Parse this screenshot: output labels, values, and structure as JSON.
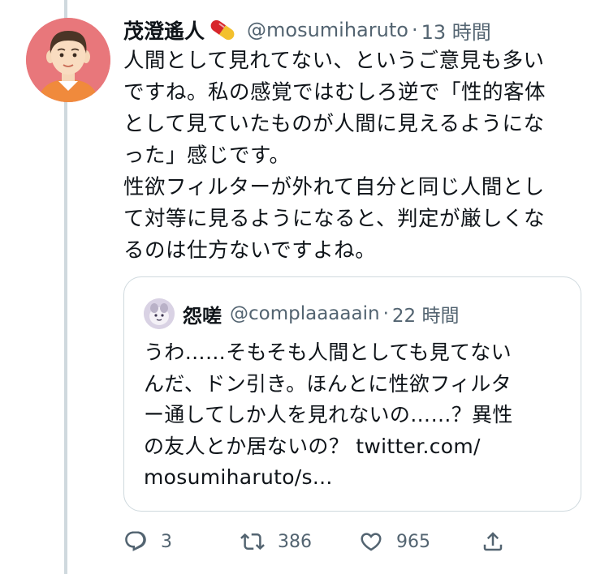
{
  "tweet": {
    "display_name": "茂澄遙人",
    "name_emoji": "pill-icon",
    "handle": "@mosumiharuto",
    "time": "13 時間",
    "body": "人間として見れてない、というご意見も多い\nですね。私の感覚ではむしろ逆で「性的客体\nとして見ていたものが人間に見えるようにな\nった」感じです。\n性欲フィルターが外れて自分と同じ人間とし\nて対等に見るようになると、判定が厳しくな\nるのは仕方ないですよね。"
  },
  "quote": {
    "display_name": "怨嗟",
    "handle": "@complaaaaain",
    "time": "22 時間",
    "body": "うわ……そもそも人間としても見てない\nんだ、ドン引き。ほんとに性欲フィルタ\nー通してしか人を見れないの……？異性\nの友人とか居ないの？ twitter.com/\nmosumiharuto/s..."
  },
  "actions": {
    "reply_count": "3",
    "retweet_count": "386",
    "like_count": "965"
  },
  "colors": {
    "text": "#0f1419",
    "secondary": "#536471",
    "border": "#cfd9de",
    "avatar_bg": "#e8777b"
  }
}
